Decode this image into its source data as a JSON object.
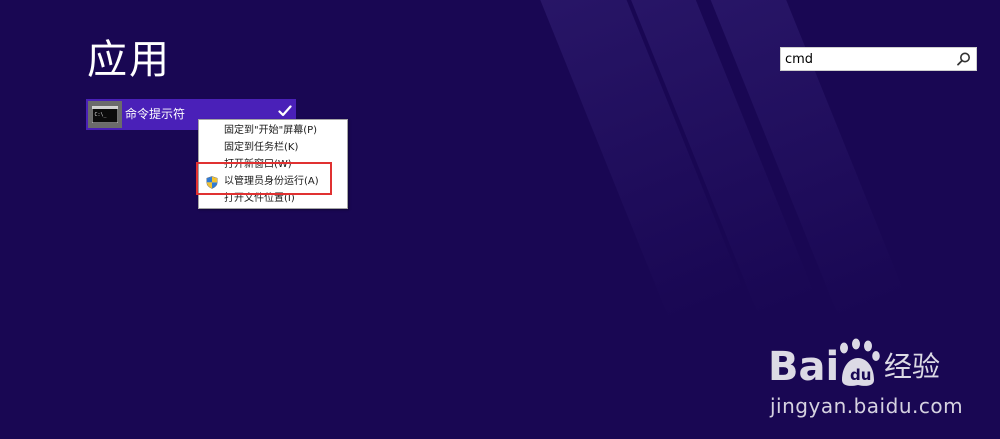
{
  "page": {
    "title": "应用"
  },
  "search": {
    "value": "cmd",
    "icon": "search-icon"
  },
  "app_tile": {
    "label": "命令提示符",
    "icon": "cmd-icon",
    "selected": true
  },
  "context_menu": {
    "items": [
      {
        "label": "固定到\"开始\"屏幕(P)"
      },
      {
        "label": "固定到任务栏(K)"
      },
      {
        "label": "打开新窗口(W)"
      },
      {
        "label": "以管理员身份运行(A)",
        "icon": "shield-icon"
      },
      {
        "label": "打开文件位置(I)"
      }
    ]
  },
  "watermark": {
    "logo_text": "Bai 经验",
    "url": "jingyan.baidu.com"
  },
  "colors": {
    "background": "#190753",
    "tile": "#4a20b8",
    "highlight": "#e03131"
  }
}
